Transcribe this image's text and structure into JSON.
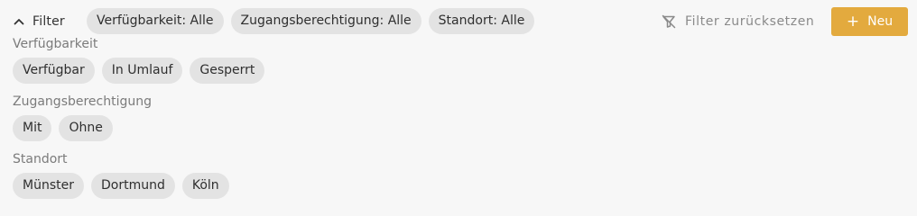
{
  "filter_bar": {
    "toggle_label": "Filter",
    "summary_chips": [
      "Verfügbarkeit: Alle",
      "Zugangsberechtigung: Alle",
      "Standort: Alle"
    ],
    "reset_label": "Filter zurücksetzen",
    "new_button_label": "Neu",
    "new_button_color": "#e3aa3e"
  },
  "groups": [
    {
      "label": "Verfügbarkeit",
      "options": [
        "Verfügbar",
        "In Umlauf",
        "Gesperrt"
      ]
    },
    {
      "label": "Zugangsberechtigung",
      "options": [
        "Mit",
        "Ohne"
      ]
    },
    {
      "label": "Standort",
      "options": [
        "Münster",
        "Dortmund",
        "Köln"
      ]
    }
  ]
}
